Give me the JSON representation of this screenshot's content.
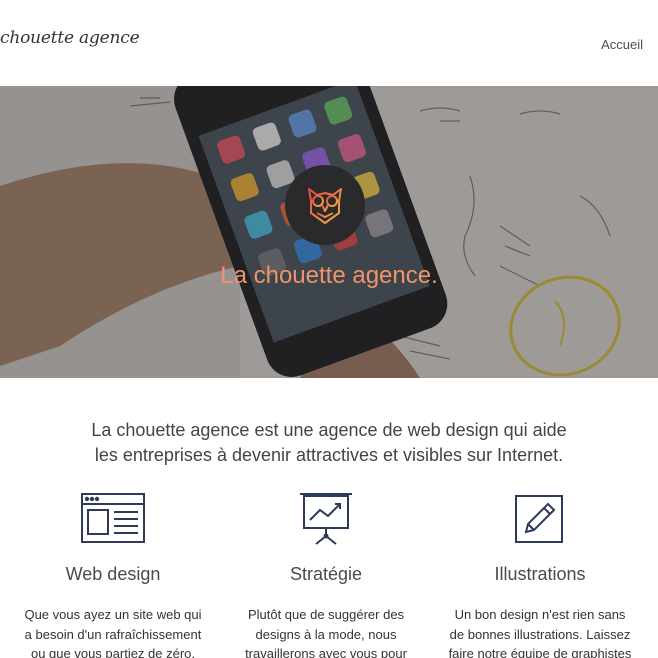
{
  "header": {
    "logo": "chouette agence",
    "nav": [
      {
        "label": "Accueil"
      }
    ]
  },
  "hero": {
    "title": "La chouette agence.",
    "logo_icon": "owl-icon",
    "background": "hand holding smartphone over paper sketches"
  },
  "intro": {
    "line1": "La chouette agence est une agence de web design qui aide",
    "line2": "les entreprises à devenir attractives et visibles sur Internet."
  },
  "features": [
    {
      "icon": "browser-window-icon",
      "title": "Web design",
      "lines": [
        "Que vous ayez un site web qui",
        "a besoin d'un rafraîchissement",
        "ou que vous partiez de zéro,"
      ]
    },
    {
      "icon": "presentation-chart-icon",
      "title": "Stratégie",
      "lines": [
        "Plutôt que de suggérer des",
        "designs à la mode, nous",
        "travaillerons avec vous pour"
      ]
    },
    {
      "icon": "pencil-edit-icon",
      "title": "Illustrations",
      "lines": [
        "Un bon design n'est rien sans",
        "de bonnes illustrations. Laissez",
        "faire notre équipe de graphistes"
      ]
    }
  ],
  "colors": {
    "accent": "#f0946a",
    "icon_stroke": "#2e3a5c",
    "owl_badge": "#2a2a2c"
  }
}
